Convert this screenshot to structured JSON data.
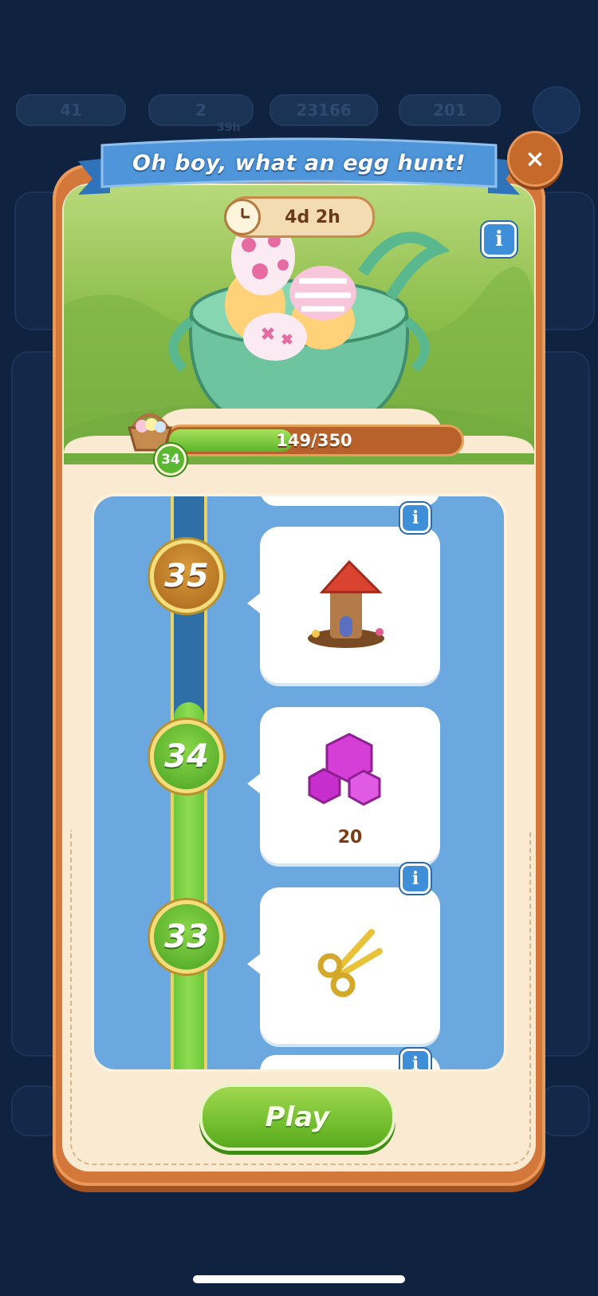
{
  "background_hud": {
    "level": "41",
    "energy": "2",
    "energy_sub": "39h",
    "coins": "23166",
    "gems": "201"
  },
  "event": {
    "title": "Oh boy, what an egg hunt!",
    "timer": "4d 2h",
    "progress_text": "149/350",
    "progress_fraction": 0.4257,
    "current_level": "34"
  },
  "rewards": [
    {
      "level": "35",
      "reward_icon": "gnome-house-icon",
      "amount": "",
      "has_info": true,
      "reached": false
    },
    {
      "level": "34",
      "reward_icon": "gems-icon",
      "amount": "20",
      "has_info": false,
      "reached": true
    },
    {
      "level": "33",
      "reward_icon": "golden-scissors-icon",
      "amount": "",
      "has_info": true,
      "reached": true
    }
  ],
  "buttons": {
    "close": "×",
    "info": "i",
    "play": "Play"
  },
  "colors": {
    "panel": "#d4773a",
    "panel_inner": "#fbead2",
    "banner": "#4e95d9",
    "track": "#6aa8df",
    "progress_green": "#5cb52c",
    "play_green": "#74bf2f",
    "backdrop": "#0f2340"
  }
}
